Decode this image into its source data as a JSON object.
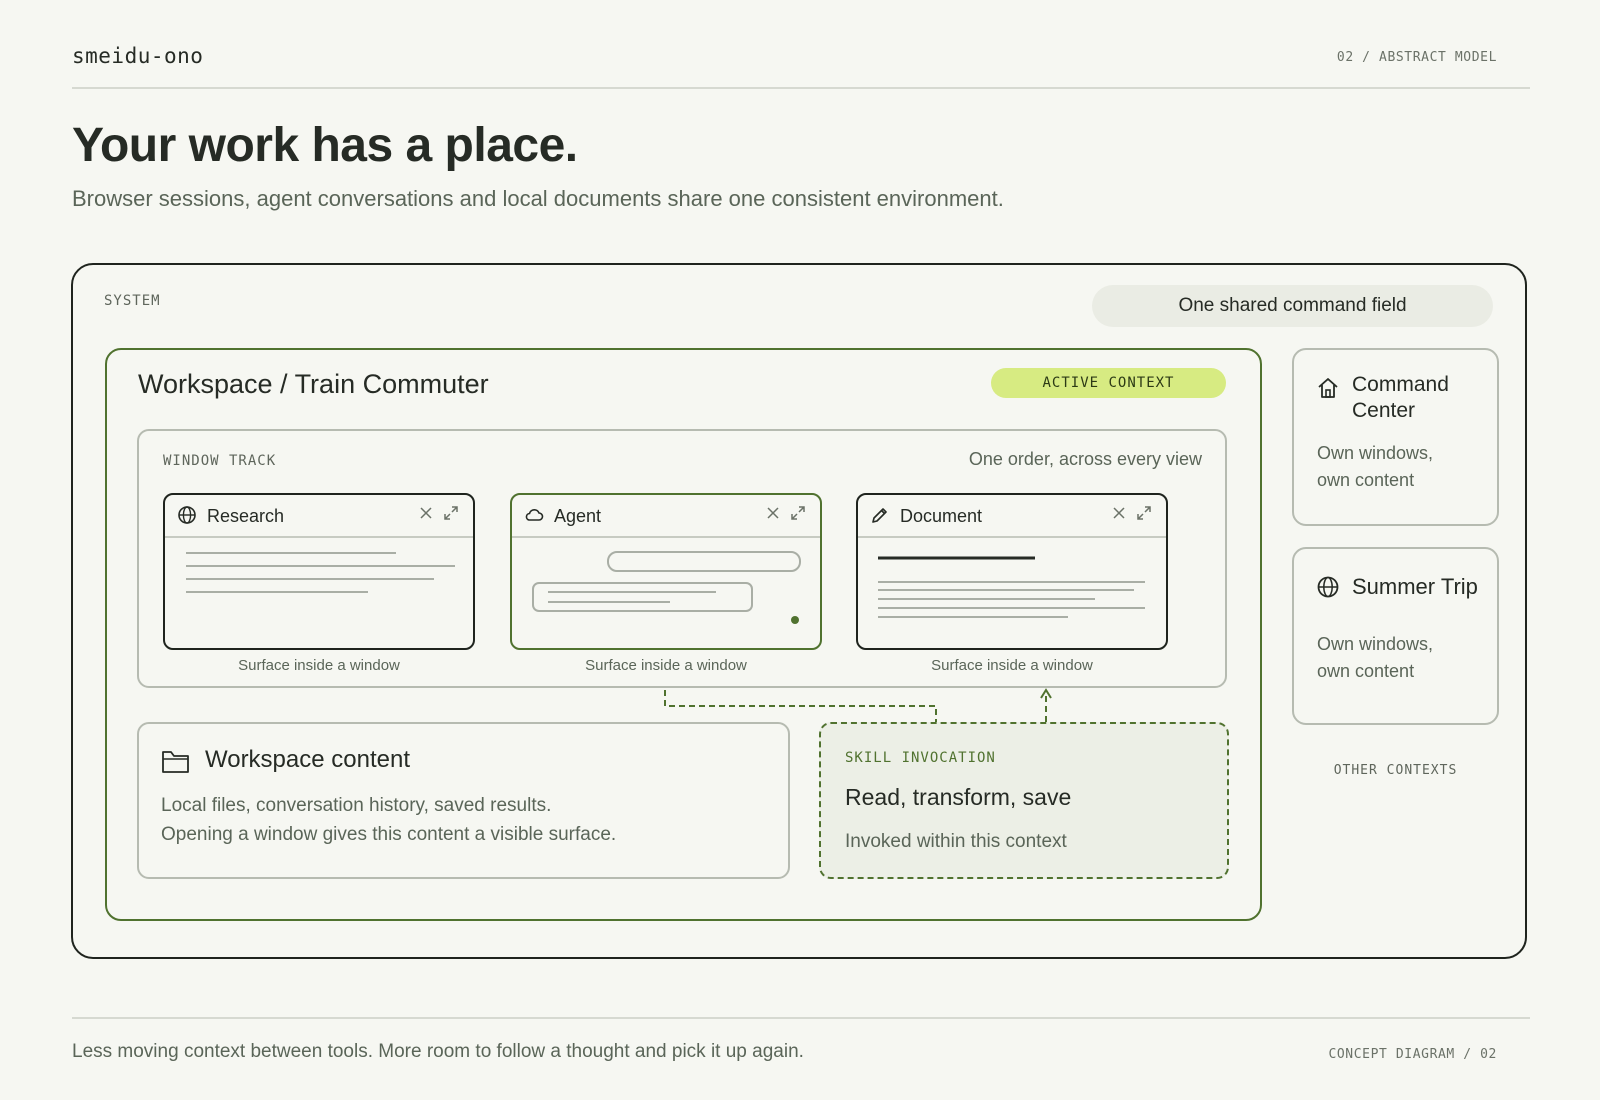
{
  "header": {
    "brand": "smeidu-ono",
    "section": "02 / ABSTRACT MODEL"
  },
  "hero": {
    "title": "Your work has a place.",
    "subtitle": "Browser sessions, agent conversations and local documents share one consistent environment."
  },
  "system": {
    "label": "SYSTEM",
    "command_field": "One shared command field",
    "workspace": {
      "title": "Workspace / Train Commuter",
      "badge": "ACTIVE CONTEXT",
      "track": {
        "label": "WINDOW TRACK",
        "note": "One order, across every view",
        "windows": [
          {
            "title": "Research",
            "icon": "globe-icon",
            "caption": "Surface inside a window"
          },
          {
            "title": "Agent",
            "icon": "cloud-icon",
            "caption": "Surface inside a window"
          },
          {
            "title": "Document",
            "icon": "pencil-icon",
            "caption": "Surface inside a window"
          }
        ]
      },
      "content": {
        "title": "Workspace content",
        "icon": "folder-icon",
        "line1": "Local files, conversation history, saved results.",
        "line2": "Opening a window gives this content a visible surface."
      },
      "skill": {
        "label": "SKILL INVOCATION",
        "title": "Read, transform, save",
        "subtitle": "Invoked within this context"
      }
    },
    "other_contexts": {
      "label": "OTHER CONTEXTS",
      "items": [
        {
          "title": "Command Center",
          "icon": "home-icon",
          "desc_line1": "Own windows,",
          "desc_line2": "own content"
        },
        {
          "title": "Summer Trip",
          "icon": "globe-icon",
          "desc_line1": "Own windows,",
          "desc_line2": "own content"
        }
      ]
    }
  },
  "footer": {
    "text": "Less moving context between tools. More room to follow a thought and pick it up again.",
    "code": "CONCEPT DIAGRAM / 02"
  },
  "colors": {
    "background": "#f6f7f2",
    "ink": "#262b25",
    "accent_green": "#50722f",
    "badge_lime": "#d7eb82",
    "muted_text": "#5a6558"
  }
}
